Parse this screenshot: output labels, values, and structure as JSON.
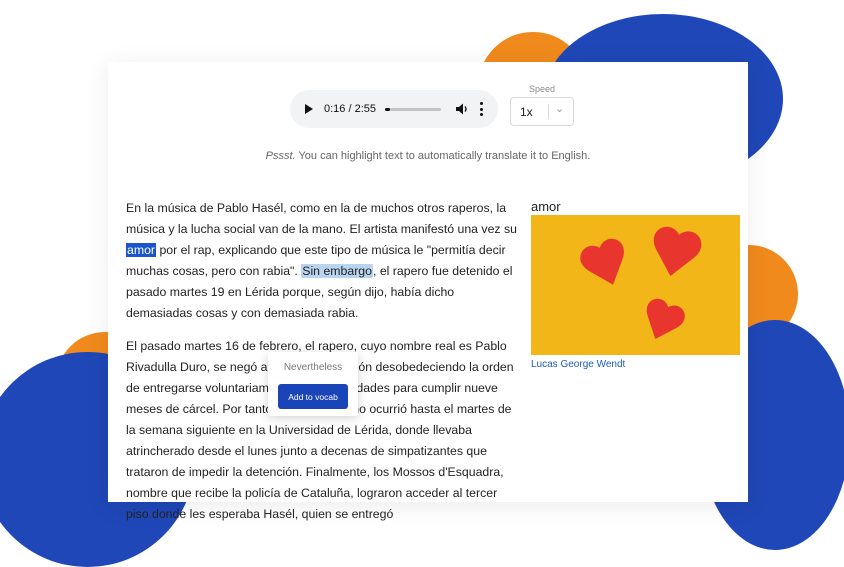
{
  "player": {
    "time": "0:16 / 2:55",
    "progress_fraction": 0.09
  },
  "speed": {
    "label": "Speed",
    "value": "1x"
  },
  "hint": {
    "emphasis": "Pssst.",
    "text": " You can highlight text to automatically translate it to English."
  },
  "article": {
    "p1": {
      "a": "En la música de Pablo Hasél, como en la de muchos otros raperos, la música y la lucha social van de la mano. El artista manifestó una vez su ",
      "selected": "amor",
      "b": " por el rap, explicando que este tipo de música le \"permitía decir muchas cosas, pero con rabia\". ",
      "highlight": "Sin embargo",
      "c": ", el rapero fue detenido el pasado martes 19 en Lérida porque, según dijo, había dicho demasiadas cosas y con demasiada rabia."
    },
    "p2": "El pasado martes 16 de febrero, el rapero, cuyo nombre real es Pablo Rivadulla Duro, se negó a ingresar en prisión desobedeciendo la orden de entregarse voluntariamente a las autoridades para cumplir nueve meses de cárcel. Por tanto, su detención no ocurrió hasta el martes de la semana siguiente en la Universidad de Lérida, donde llevaba atrincherado desde el lunes junto a decenas de simpatizantes que trataron de impedir la detención. Finalmente, los Mossos d'Esquadra, nombre que recibe la policía de Cataluña, lograron acceder al tercer piso donde les esperaba Hasél, quien se entregó"
  },
  "popup": {
    "translation": "Nevertheless",
    "button": "Add to vocab"
  },
  "sidebar": {
    "word": "amor",
    "image_credit": "Lucas George Wendt"
  },
  "colors": {
    "accent": "#1a45b8",
    "blob_orange": "#f08a1c",
    "blob_blue": "#1f47b7",
    "image_bg": "#f2b619",
    "heart": "#e8362f"
  }
}
